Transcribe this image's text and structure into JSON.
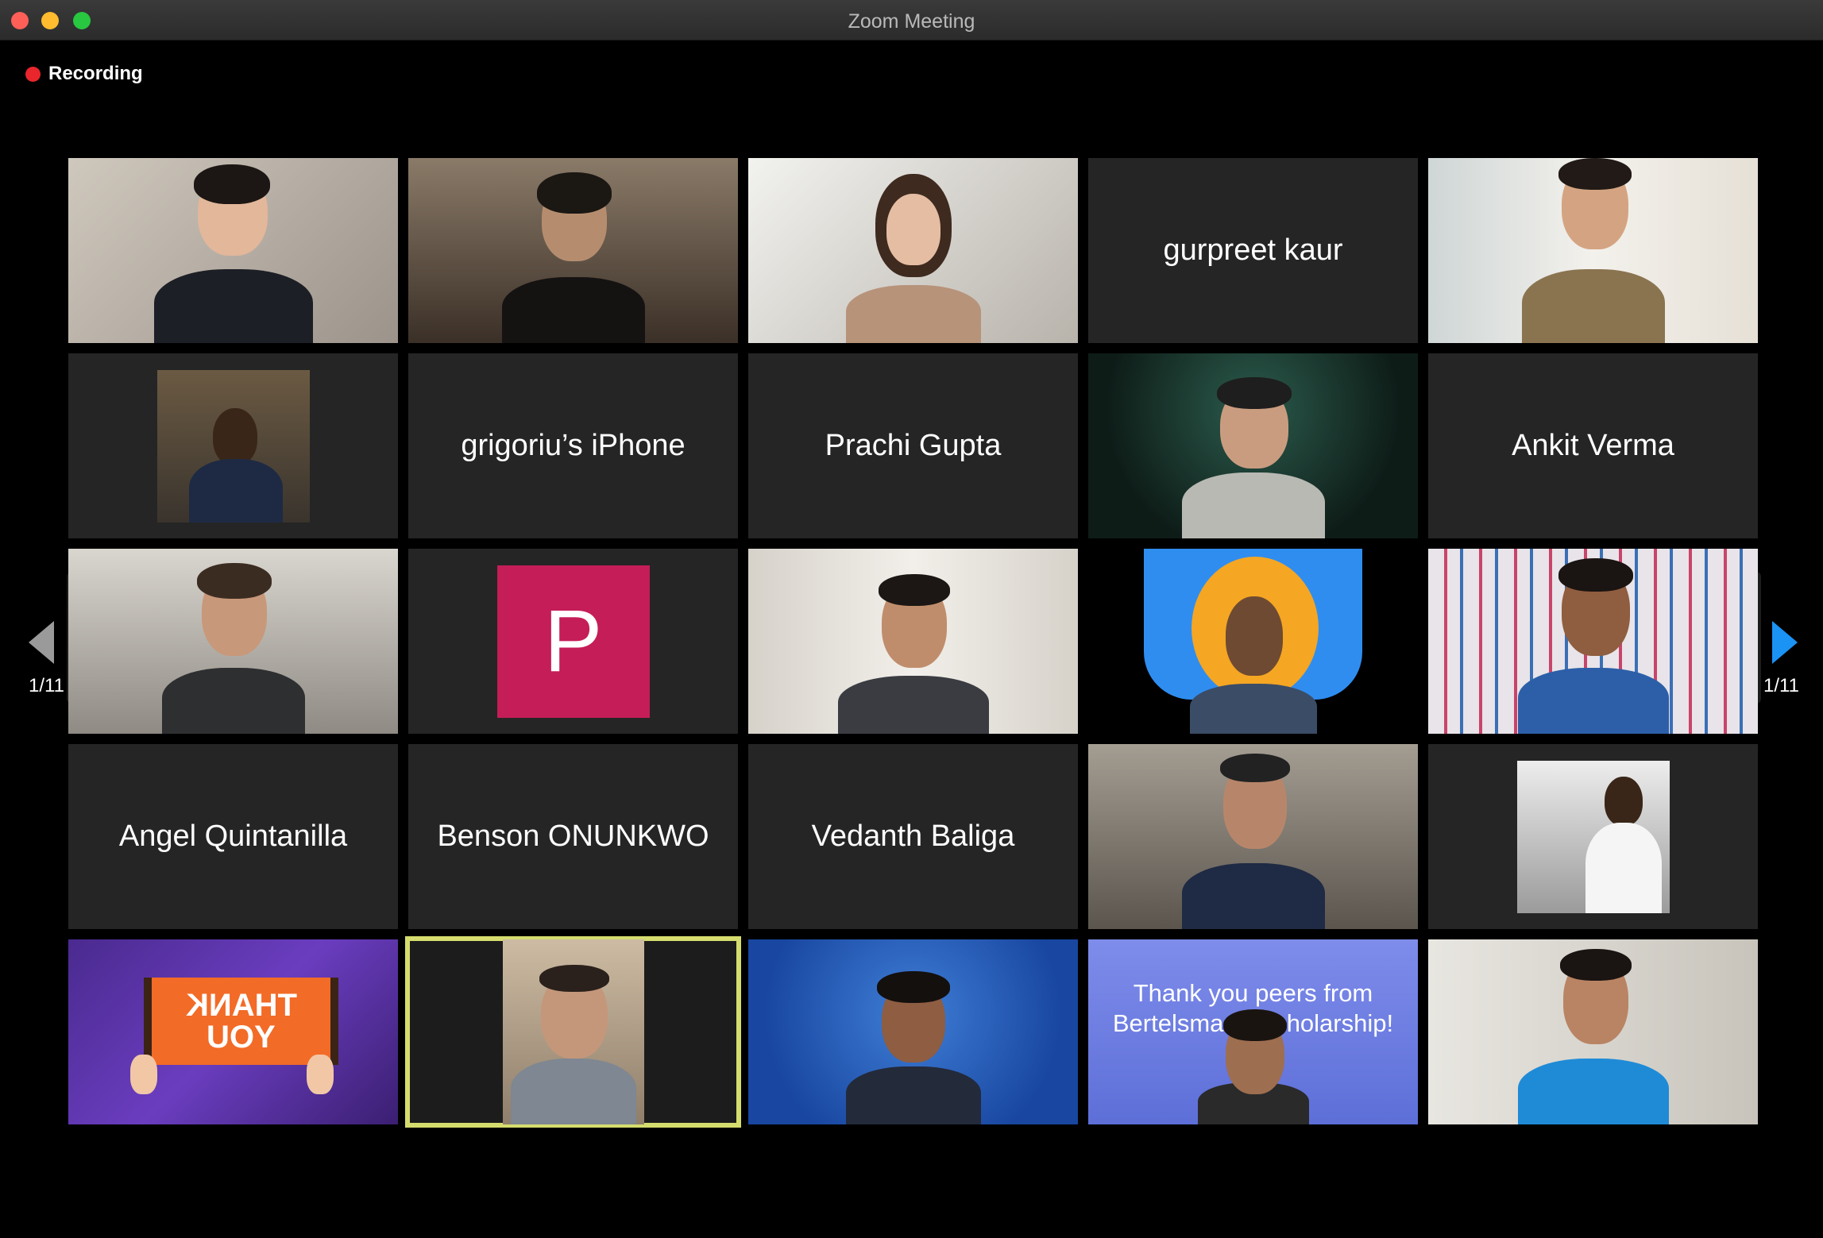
{
  "window": {
    "title": "Zoom Meeting"
  },
  "status": {
    "recording_label": "Recording",
    "recording_color": "#e8262b"
  },
  "pagination": {
    "left_label": "1/11",
    "right_label": "1/11"
  },
  "tiles": [
    {
      "kind": "video"
    },
    {
      "kind": "video"
    },
    {
      "kind": "video"
    },
    {
      "kind": "name",
      "name": "gurpreet kaur"
    },
    {
      "kind": "video"
    },
    {
      "kind": "photo"
    },
    {
      "kind": "name",
      "name": "grigoriu’s iPhone"
    },
    {
      "kind": "name",
      "name": "Prachi Gupta"
    },
    {
      "kind": "video"
    },
    {
      "kind": "name",
      "name": "Ankit Verma"
    },
    {
      "kind": "video"
    },
    {
      "kind": "avatar",
      "initial": "P"
    },
    {
      "kind": "video"
    },
    {
      "kind": "video"
    },
    {
      "kind": "video"
    },
    {
      "kind": "name",
      "name": "Angel Quintanilla"
    },
    {
      "kind": "name",
      "name": "Benson ONUNKWO"
    },
    {
      "kind": "name",
      "name": "Vedanth Baliga"
    },
    {
      "kind": "video"
    },
    {
      "kind": "photo"
    },
    {
      "kind": "video",
      "sign_line1": "THANK",
      "sign_line2": "YOU"
    },
    {
      "kind": "video",
      "active_speaker": true
    },
    {
      "kind": "video"
    },
    {
      "kind": "video",
      "card_line1": "Thank you peers from",
      "card_line2": "Bertelsmann Scholarship!"
    },
    {
      "kind": "video"
    }
  ],
  "colors": {
    "active_speaker_border": "#d5dc6e",
    "next_arrow": "#1a93f5",
    "avatar_bg": "#c51d58"
  }
}
